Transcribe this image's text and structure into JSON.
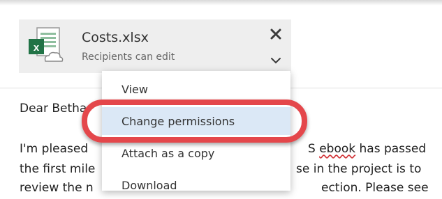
{
  "attachment": {
    "file_name": "Costs.xlsx",
    "subtitle": "Recipients can edit",
    "icon": "excel-cloud-file-icon"
  },
  "email_body": {
    "greeting": "Dear Beth",
    "greeting_tail": "ar",
    "line1_start": "I'm pleased ",
    "line1_end_a": "S ",
    "line1_ebook": "ebook",
    "line1_end_b": " has passed",
    "line2_start": "the first mile",
    "line2_end": "se in the project is to",
    "line3_start": "review the n",
    "line3_end": "ection. Please see"
  },
  "menu": {
    "items": [
      {
        "label": "View"
      },
      {
        "label": "Change permissions"
      },
      {
        "label": "Attach as a copy"
      },
      {
        "label": "Download"
      }
    ],
    "highlighted_index": 1
  },
  "colors": {
    "annotation": "#e4474b",
    "highlight": "#dbe8f6",
    "excel_green": "#217346"
  }
}
